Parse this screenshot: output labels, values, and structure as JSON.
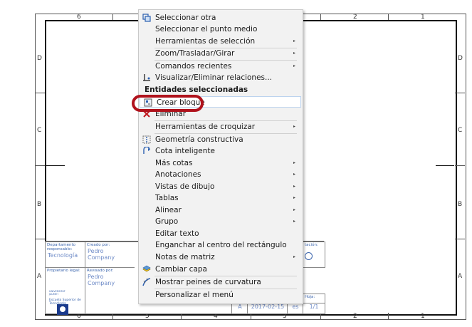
{
  "drawing": {
    "col_numbers": [
      "6",
      "5",
      "4",
      "3",
      "2",
      "1"
    ],
    "row_letters": [
      "D",
      "C",
      "B",
      "A"
    ],
    "title_block": {
      "dept_label": "Departamento responsable:",
      "dept_value": "Tecnología",
      "created_label": "Creado por:",
      "created_value": "Pedro Company",
      "owner_label": "Propietario legal:",
      "reviewed_label": "Revisado por:",
      "reviewed_value": "Pedro Company",
      "owner_caption": "Escuela Superior de Tecnología",
      "logo_text": "UNIVERSITAT JAUME·I",
      "situation_label": "tación:",
      "revision": "A",
      "date": "2017-02-15",
      "lang": "es",
      "sheet_label": "Hoja:",
      "sheet_value": "1/1"
    }
  },
  "menu": {
    "items": [
      {
        "label": "Seleccionar otra",
        "icon": "select-other-icon"
      },
      {
        "label": "Seleccionar el punto medio"
      },
      {
        "label": "Herramientas de selección",
        "submenu": true
      },
      {
        "label": "Zoom/Trasladar/Girar",
        "submenu": true
      },
      {
        "label": "Comandos recientes",
        "submenu": true
      },
      {
        "label": "Visualizar/Eliminar relaciones...",
        "icon": "relations-icon"
      },
      {
        "label": "Entidades seleccionadas",
        "section": true
      },
      {
        "label": "Crear bloque",
        "icon": "block-icon",
        "highlight": true
      },
      {
        "label": "Eliminar",
        "icon": "delete-icon"
      },
      {
        "label": "Herramientas de croquizar",
        "submenu": true
      },
      {
        "label": "Geometría constructiva",
        "icon": "construction-geometry-icon"
      },
      {
        "label": "Cota inteligente",
        "icon": "smart-dimension-icon"
      },
      {
        "label": "Más cotas",
        "submenu": true
      },
      {
        "label": "Anotaciones",
        "submenu": true
      },
      {
        "label": "Vistas de dibujo",
        "submenu": true
      },
      {
        "label": "Tablas",
        "submenu": true
      },
      {
        "label": "Alinear",
        "submenu": true
      },
      {
        "label": "Grupo",
        "submenu": true
      },
      {
        "label": "Editar texto"
      },
      {
        "label": "Enganchar al centro del rectángulo"
      },
      {
        "label": "Notas de matriz",
        "submenu": true
      },
      {
        "label": "Cambiar capa",
        "icon": "layer-icon"
      },
      {
        "label": "Mostrar peines de curvatura",
        "icon": "curvature-icon"
      },
      {
        "label": "Personalizar el menú"
      }
    ],
    "arrow_glyph": "▸"
  },
  "colors": {
    "annotation_red": "#b0121c",
    "title_block_blue": "#3a64ad"
  }
}
